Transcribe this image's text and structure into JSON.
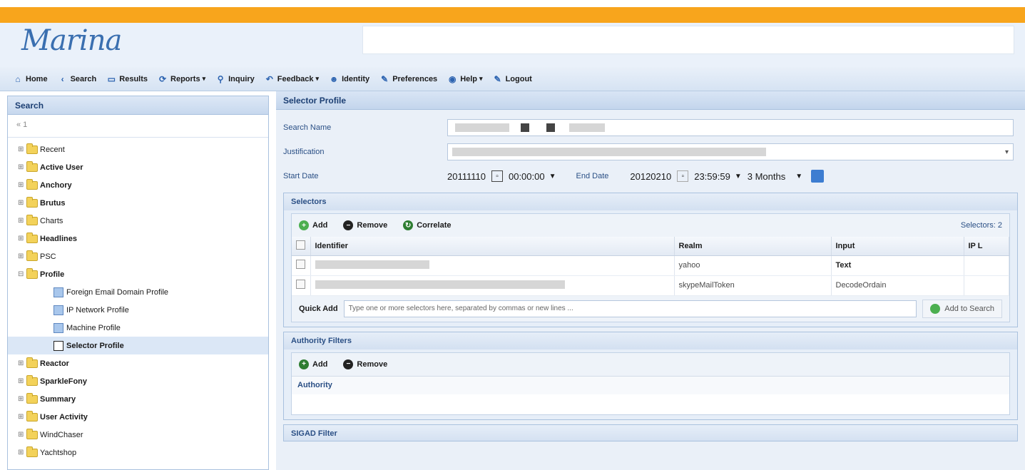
{
  "app": {
    "logo": "Marina"
  },
  "menu": [
    {
      "label": "Home",
      "icon": "home-icon",
      "glyph": "⌂",
      "caret": false
    },
    {
      "label": "Search",
      "icon": "search-icon",
      "glyph": "‹",
      "caret": false
    },
    {
      "label": "Results",
      "icon": "results-icon",
      "glyph": "▭",
      "caret": false
    },
    {
      "label": "Reports",
      "icon": "reports-icon",
      "glyph": "⟳",
      "caret": true
    },
    {
      "label": "Inquiry",
      "icon": "inquiry-icon",
      "glyph": "⚲",
      "caret": false
    },
    {
      "label": "Feedback",
      "icon": "feedback-icon",
      "glyph": "↶",
      "caret": true
    },
    {
      "label": "Identity",
      "icon": "identity-icon",
      "glyph": "☻",
      "caret": false
    },
    {
      "label": "Preferences",
      "icon": "preferences-icon",
      "glyph": "✎",
      "caret": false
    },
    {
      "label": "Help",
      "icon": "help-icon",
      "glyph": "◉",
      "caret": true
    },
    {
      "label": "Logout",
      "icon": "logout-icon",
      "glyph": "✎",
      "caret": false
    }
  ],
  "left": {
    "title": "Search",
    "toolbar": "« 1",
    "tree": [
      {
        "label": "Recent",
        "bold": false,
        "exp": "⊞"
      },
      {
        "label": "Active User",
        "bold": true,
        "exp": "⊞"
      },
      {
        "label": "Anchory",
        "bold": true,
        "exp": "⊞"
      },
      {
        "label": "Brutus",
        "bold": true,
        "exp": "⊞"
      },
      {
        "label": "Charts",
        "bold": false,
        "exp": "⊞"
      },
      {
        "label": "Headlines",
        "bold": true,
        "exp": "⊞"
      },
      {
        "label": "PSC",
        "bold": false,
        "exp": "⊞"
      },
      {
        "label": "Profile",
        "bold": true,
        "exp": "⊟"
      }
    ],
    "profile_children": [
      {
        "label": "Foreign Email Domain Profile",
        "selected": false
      },
      {
        "label": "IP Network Profile",
        "selected": false
      },
      {
        "label": "Machine Profile",
        "selected": false
      },
      {
        "label": "Selector Profile",
        "selected": true
      }
    ],
    "tree_after": [
      {
        "label": "Reactor",
        "bold": true,
        "exp": "⊞"
      },
      {
        "label": "SparkleFony",
        "bold": true,
        "exp": "⊞"
      },
      {
        "label": "Summary",
        "bold": true,
        "exp": "⊞"
      },
      {
        "label": "User Activity",
        "bold": true,
        "exp": "⊞"
      },
      {
        "label": "WindChaser",
        "bold": false,
        "exp": "⊞"
      },
      {
        "label": "Yachtshop",
        "bold": false,
        "exp": "⊞"
      }
    ]
  },
  "right": {
    "title": "Selector Profile",
    "form": {
      "search_name_label": "Search Name",
      "justification_label": "Justification",
      "start_date_label": "Start Date",
      "start_date": "20111110",
      "start_time": "00:00:00",
      "end_date_label": "End Date",
      "end_date": "20120210",
      "end_time": "23:59:59",
      "range": "3 Months"
    },
    "selectors": {
      "title": "Selectors",
      "add": "Add",
      "remove": "Remove",
      "correlate": "Correlate",
      "count": "Selectors: 2",
      "columns": [
        "Identifier",
        "Realm",
        "Input",
        "IP L"
      ],
      "rows": [
        {
          "realm": "yahoo",
          "input": "Text"
        },
        {
          "realm": "skypeMailToken",
          "input": "DecodeOrdain"
        }
      ],
      "quick_add_label": "Quick Add",
      "quick_add_placeholder": "Type one or more selectors here, separated by commas or new lines ...",
      "add_to_search": "Add to Search"
    },
    "authority": {
      "title": "Authority Filters",
      "add": "Add",
      "remove": "Remove",
      "column": "Authority"
    },
    "sigad": {
      "title": "SIGAD Filter"
    }
  }
}
